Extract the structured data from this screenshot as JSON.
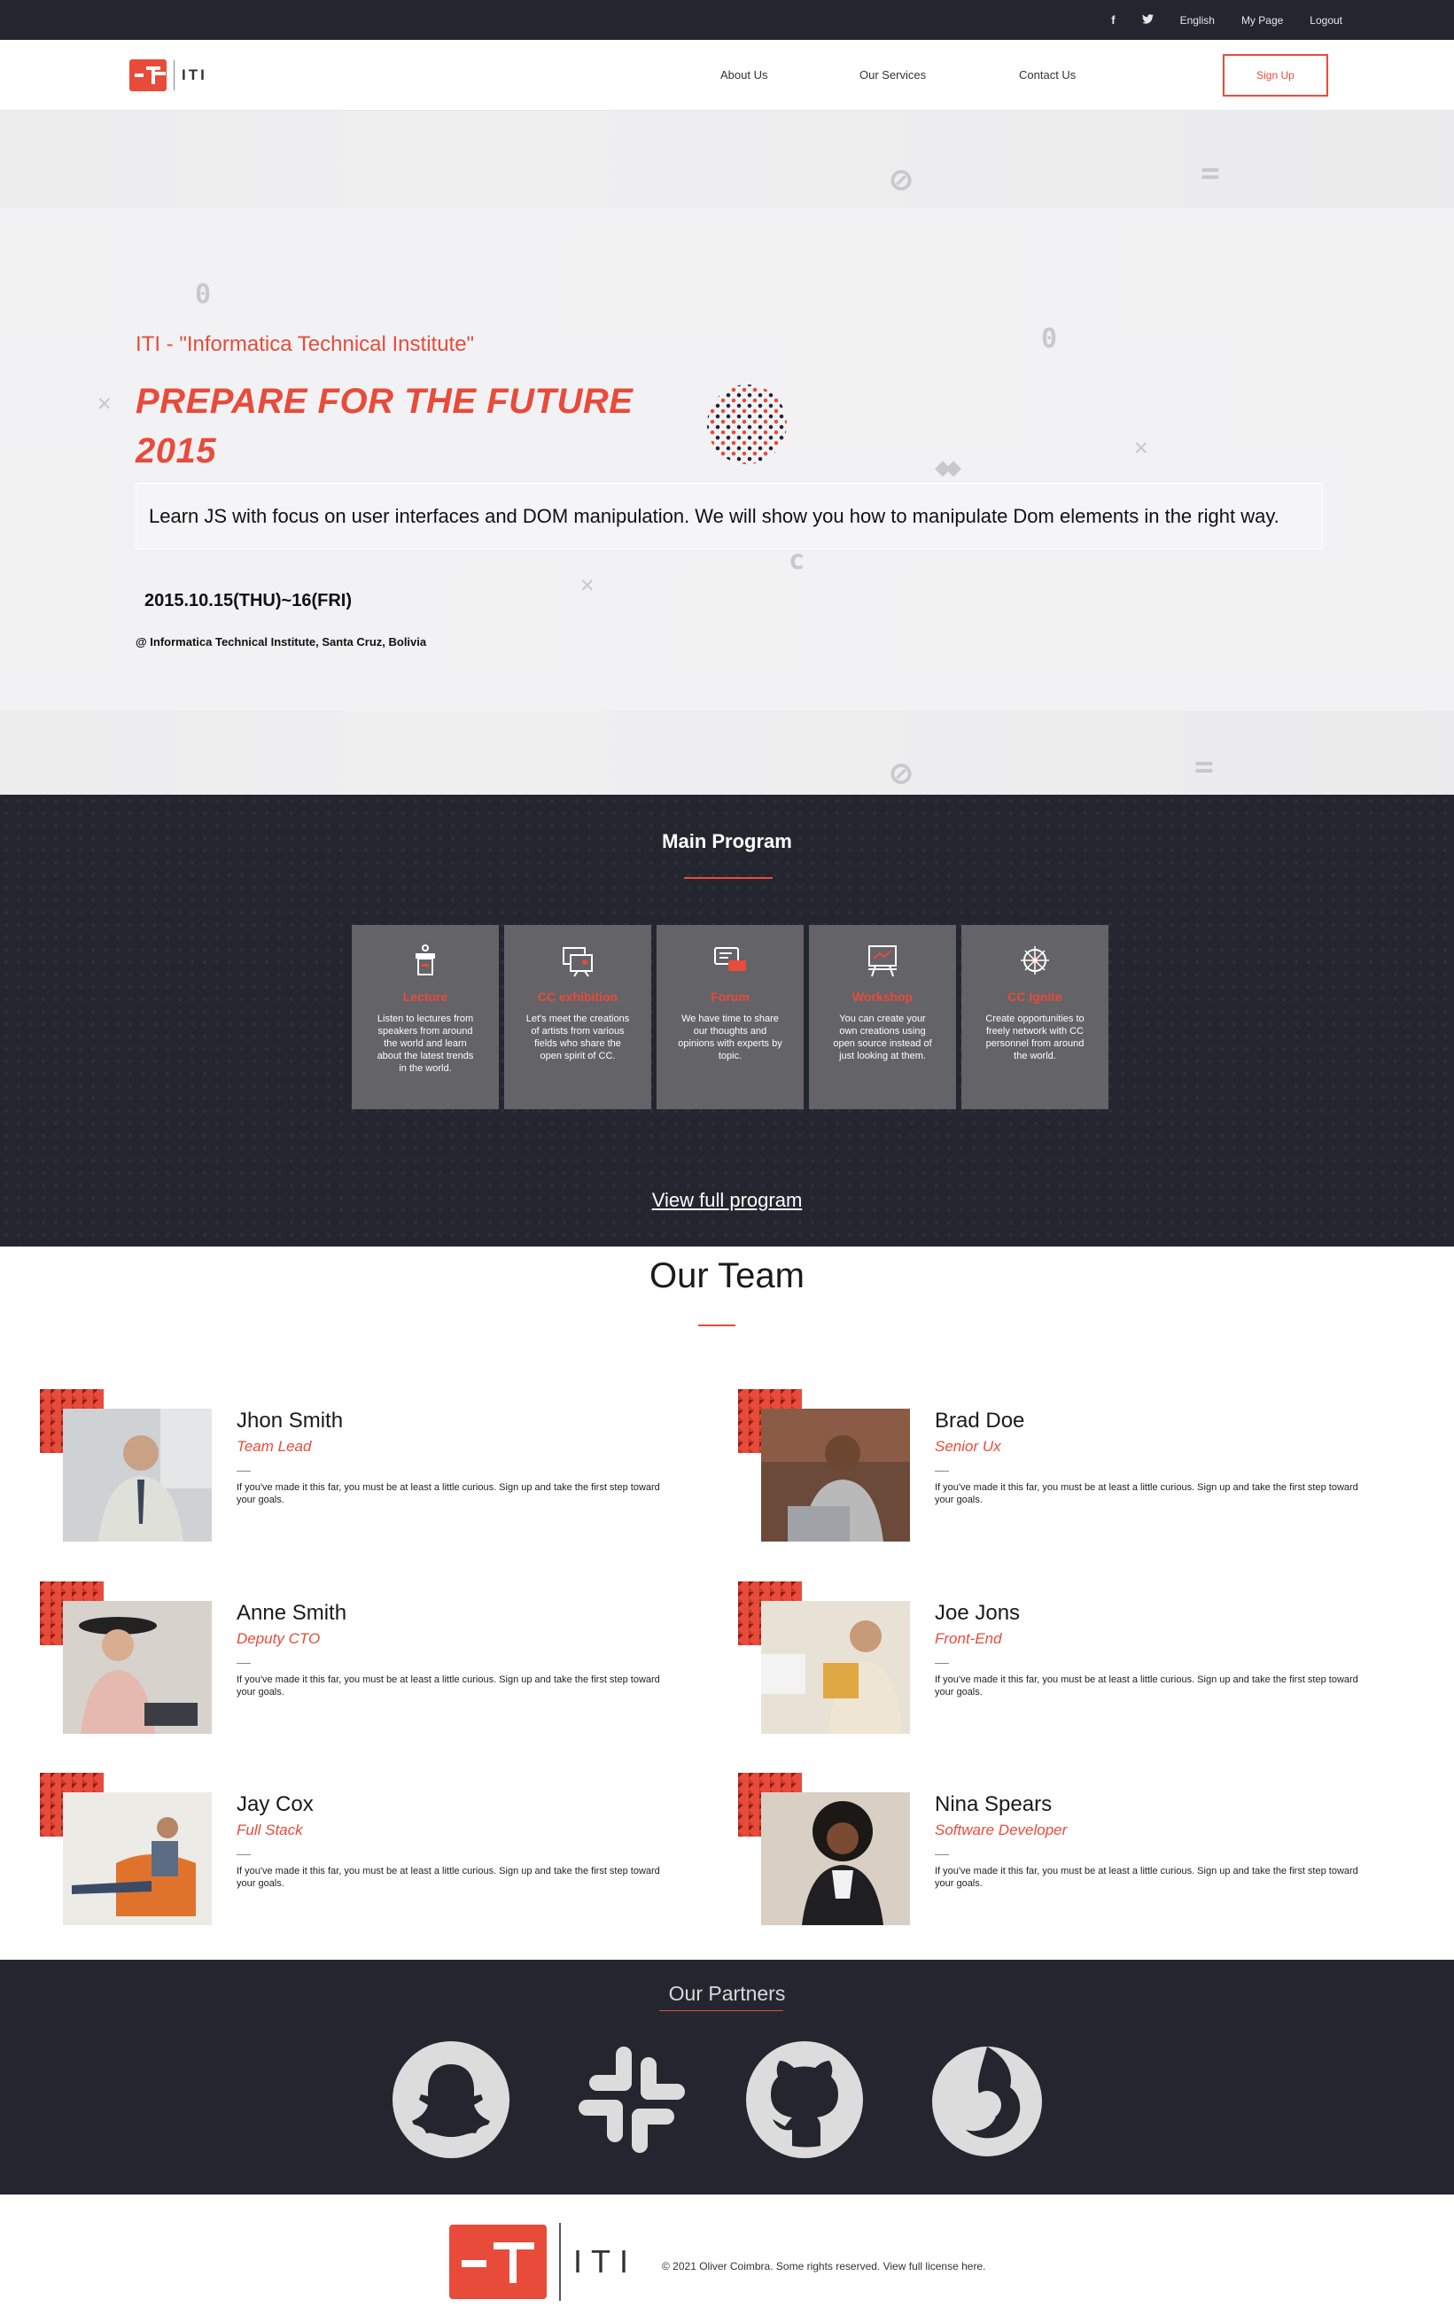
{
  "topbar": {
    "facebook_icon": "facebook-icon",
    "twitter_icon": "twitter-icon",
    "language": "English",
    "my_page": "My Page",
    "logout": "Logout"
  },
  "header": {
    "logo_text": "ITI",
    "nav": [
      "About Us",
      "Our Services",
      "Contact Us"
    ],
    "signup": "Sign Up"
  },
  "hero": {
    "subtitle": "ITI - \"Informatica Technical Institute\"",
    "headline_line1": "PREPARE FOR THE FUTURE",
    "headline_line2": "2015",
    "description": "Learn JS with focus on user interfaces and DOM manipulation. We will show you how to manipulate Dom elements in the right way.",
    "date": "2015.10.15(THU)~16(FRI)",
    "location": "@ Informatica Technical Institute, Santa Cruz, Bolivia"
  },
  "program": {
    "title": "Main Program",
    "cards": [
      {
        "icon": "lecture-icon",
        "title": "Lecture",
        "text": "Listen to lectures from speakers from around the world and learn about the latest trends in the world."
      },
      {
        "icon": "exhibition-icon",
        "title": "CC exhibition",
        "text": "Let's meet the creations of artists from various fields who share the open spirit of CC."
      },
      {
        "icon": "forum-icon",
        "title": "Forum",
        "text": "We have time to share our thoughts and opinions with experts by topic."
      },
      {
        "icon": "workshop-icon",
        "title": "Workshop",
        "text": "You can create your own creations using open source instead of just looking at them."
      },
      {
        "icon": "network-icon",
        "title": "CC Ignite",
        "text": "Create opportunities to freely network with CC personnel from around the world."
      }
    ],
    "view_full": "View full program"
  },
  "team": {
    "title": "Our Team",
    "members": [
      {
        "name": "Jhon Smith",
        "role": "Team Lead",
        "bio": "If you've made it this far, you must be at least a little curious. Sign up and take the first step toward your goals."
      },
      {
        "name": "Brad Doe",
        "role": "Senior Ux",
        "bio": "If you've made it this far, you must be at least a little curious. Sign up and take the first step toward your goals."
      },
      {
        "name": "Anne Smith",
        "role": "Deputy CTO",
        "bio": "If you've made it this far, you must be at least a little curious. Sign up and take the first step toward your goals."
      },
      {
        "name": "Joe Jons",
        "role": "Front-End",
        "bio": "If you've made it this far, you must be at least a little curious. Sign up and take the first step toward your goals."
      },
      {
        "name": "Jay Cox",
        "role": "Full Stack",
        "bio": "If you've made it this far, you must be at least a little curious. Sign up and take the first step toward your goals."
      },
      {
        "name": "Nina Spears",
        "role": "Software Developer",
        "bio": "If you've made it this far, you must be at least a little curious. Sign up and take the first step toward your goals."
      }
    ]
  },
  "partners": {
    "title": "Our Partners",
    "logos": [
      "snapchat-icon",
      "slack-icon",
      "github-icon",
      "firefox-icon"
    ]
  },
  "footer": {
    "logo_text": "ITI",
    "copyright": "© 2021 Oliver Coimbra. Some rights reserved. View full license here."
  },
  "colors": {
    "accent": "#e84b3a",
    "dark": "#24262f",
    "card": "#636368"
  }
}
